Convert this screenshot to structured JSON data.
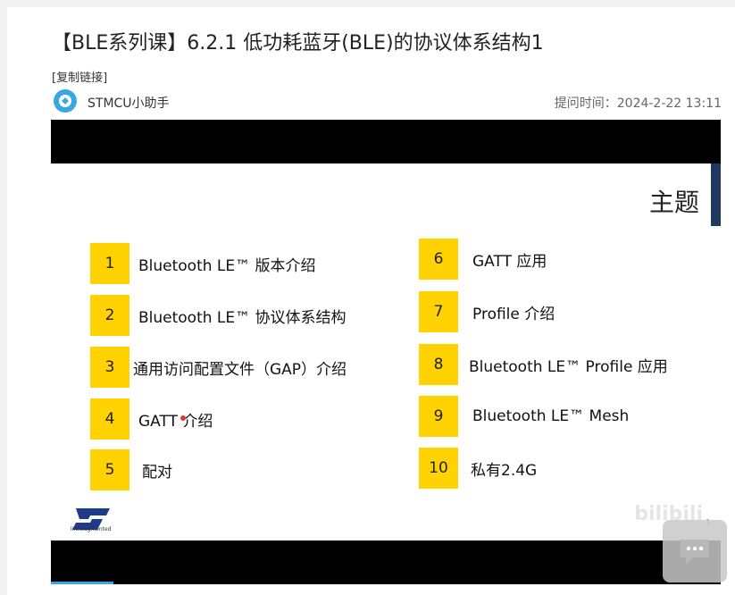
{
  "post": {
    "title": "【BLE系列课】6.2.1 低功耗蓝牙(BLE)的协议体系结构1",
    "copy_link": "[复制链接]",
    "author": "STMCU小助手",
    "post_time": "提问时间：2024-2-22 13:11"
  },
  "slide": {
    "heading": "主题",
    "topics": [
      {
        "num": "1",
        "label": "Bluetooth LE™ 版本介绍"
      },
      {
        "num": "2",
        "label": "Bluetooth LE™ 协议体系结构"
      },
      {
        "num": "3",
        "label": "通用访问配置文件（GAP）介绍"
      },
      {
        "num": "4",
        "label": "GATT 介绍"
      },
      {
        "num": "5",
        "label": "配对"
      },
      {
        "num": "6",
        "label": "GATT 应用"
      },
      {
        "num": "7",
        "label": "Profile 介绍"
      },
      {
        "num": "8",
        "label": "Bluetooth LE™ Profile 应用"
      },
      {
        "num": "9",
        "label": "Bluetooth LE™ Mesh"
      },
      {
        "num": "10",
        "label": "私有2.4G"
      }
    ],
    "logo_tagline": "life.augmented",
    "page_number": "1",
    "watermark": "bilibili"
  },
  "colors": {
    "accent_yellow": "#ffd200",
    "brand_blue": "#3aa7e0",
    "dark_navy": "#1e3a5f"
  }
}
